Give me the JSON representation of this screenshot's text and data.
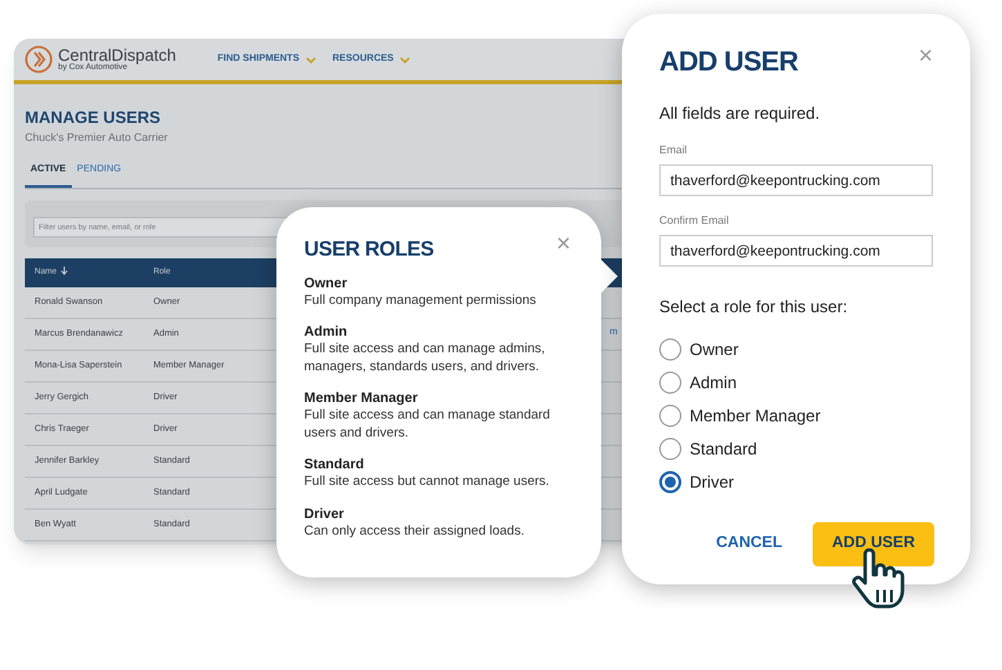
{
  "app": {
    "logo": {
      "name": "CentralDispatch",
      "tagline": "by Cox Automotive"
    },
    "nav": [
      {
        "label": "FIND SHIPMENTS"
      },
      {
        "label": "RESOURCES"
      }
    ],
    "title": "MANAGE USERS",
    "subtitle": "Chuck's Premier Auto Carrier",
    "tabs": [
      {
        "label": "ACTIVE",
        "selected": true
      },
      {
        "label": "PENDING",
        "selected": false
      }
    ],
    "filter": {
      "placeholder": "Filter users by name, email, or role"
    },
    "table": {
      "columns": [
        "Name",
        "Role"
      ],
      "rows": [
        {
          "name": "Ronald Swanson",
          "role": "Owner"
        },
        {
          "name": "Marcus Brendanawicz",
          "role": "Admin",
          "column_3": "m"
        },
        {
          "name": "Mona-Lisa Saperstein",
          "role": "Member Manager"
        },
        {
          "name": "Jerry Gergich",
          "role": "Driver"
        },
        {
          "name": "Chris Traeger",
          "role": "Driver"
        },
        {
          "name": "Jennifer Barkley",
          "role": "Standard"
        },
        {
          "name": "April Ludgate",
          "role": "Standard"
        },
        {
          "name": "Ben Wyatt",
          "role": "Standard"
        }
      ]
    }
  },
  "roles_popup": {
    "title": "USER ROLES",
    "close": "×",
    "roles": [
      {
        "name": "Owner",
        "description": "Full company management permissions"
      },
      {
        "name": "Admin",
        "description": "Full site access and can manage admins, managers, standards users, and drivers."
      },
      {
        "name": "Member Manager",
        "description": "Full site access and can manage standard users and drivers."
      },
      {
        "name": "Standard",
        "description": "Full site access but cannot manage users."
      },
      {
        "name": "Driver",
        "description": "Can only access their assigned loads."
      }
    ]
  },
  "add_user": {
    "title": "ADD USER",
    "close": "×",
    "note": "All fields are required.",
    "fields": [
      {
        "label": "Email",
        "value": "thaverford@keepontrucking.com"
      },
      {
        "label": "Confirm Email",
        "value": "thaverford@keepontrucking.com"
      }
    ],
    "role_prompt": "Select a role for this user:",
    "options": [
      {
        "label": "Owner",
        "selected": false
      },
      {
        "label": "Admin",
        "selected": false
      },
      {
        "label": "Member Manager",
        "selected": false
      },
      {
        "label": "Standard",
        "selected": false
      },
      {
        "label": "Driver",
        "selected": true
      }
    ],
    "buttons": [
      {
        "kind": "link",
        "label": "CANCEL"
      },
      {
        "kind": "primary",
        "label": "ADD USER"
      }
    ]
  }
}
